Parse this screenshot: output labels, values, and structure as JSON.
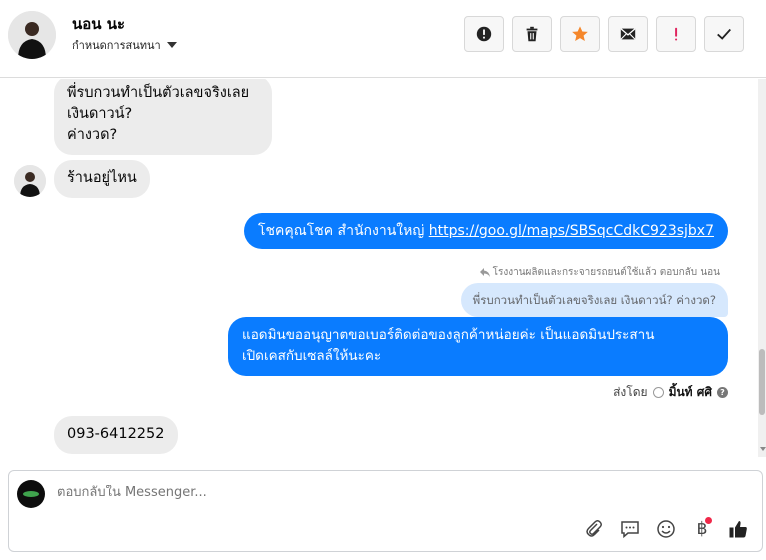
{
  "header": {
    "name": "นอน นะ",
    "subtitle": "กำหนดการสนทนา",
    "toolbar": [
      "alert-icon",
      "trash-icon",
      "star-icon",
      "mail-icon",
      "exclamation-icon",
      "check-icon"
    ]
  },
  "colors": {
    "accent": "#0a7cff",
    "star": "#f5872b",
    "exclaim": "#e0245e",
    "incoming_bg": "#ececec",
    "quote_bg": "#d6e8fd"
  },
  "messages": {
    "m1_line1": "พี่รบกวนทำเป็นตัวเลขจริงเลย",
    "m1_line2": "เงินดาวน์?",
    "m1_line3": "ค่างวด?",
    "m2": "ร้านอยู่ไหน",
    "m3_text": "โชคคุณโชค สำนักงานใหญ่ ",
    "m3_link": "https://goo.gl/maps/SBSqcCdkC923sjbx7",
    "reply_note": "โรงงานผลิตและกระจายรถยนต์ใช้แล้ว ตอบกลับ นอน",
    "quote": "พี่รบกวนทำเป็นตัวเลขจริงเลย เงินดาวน์? ค่างวด?",
    "m4_line1": "แอดมินขออนุญาตขอเบอร์ติดต่อของลูกค้าหน่อยค่ะ เป็นแอดมินประสาน",
    "m4_line2": "เปิดเคสกับเซลล์ให้นะคะ",
    "sent_by_label": "ส่งโดย",
    "sent_by_name": "มิ้นท์ ศศิ",
    "m5": "093-6412252"
  },
  "composer": {
    "placeholder": "ตอบกลับใน Messenger...",
    "icons": [
      "attach-icon",
      "saved-reply-icon",
      "emoji-icon",
      "baht-icon",
      "like-icon"
    ],
    "baht_symbol": "฿"
  }
}
